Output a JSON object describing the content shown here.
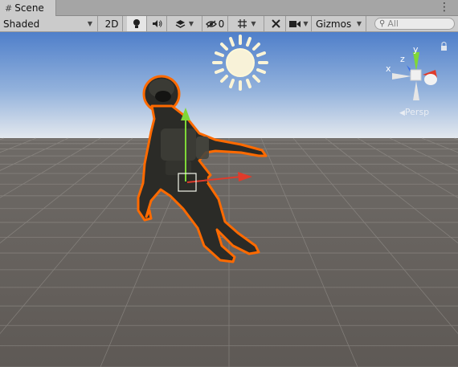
{
  "tab": {
    "title": "Scene",
    "icon": "grid-icon"
  },
  "toolbar": {
    "shading_mode": "Shaded",
    "view_2d_label": "2D",
    "hidden_objects_count": "0",
    "gizmos_label": "Gizmos",
    "search_placeholder": "All",
    "icons": [
      "lighting-icon",
      "audio-icon",
      "effects-icon",
      "visibility-icon",
      "grid-snap-icon",
      "tools-icon",
      "camera-icon",
      "search-icon"
    ]
  },
  "viewport": {
    "projection_label": "Persp",
    "orientation_axes": {
      "y": "y",
      "x": "x",
      "z": "z"
    },
    "colors": {
      "sky_top": "#4f7fca",
      "horizon": "#e3e8ee",
      "ground": "#635e5a",
      "selection_outline": "#ff6a00",
      "axis_x": "#e03b2b",
      "axis_y": "#7fd837",
      "axis_z": "#3b6fe6"
    }
  }
}
